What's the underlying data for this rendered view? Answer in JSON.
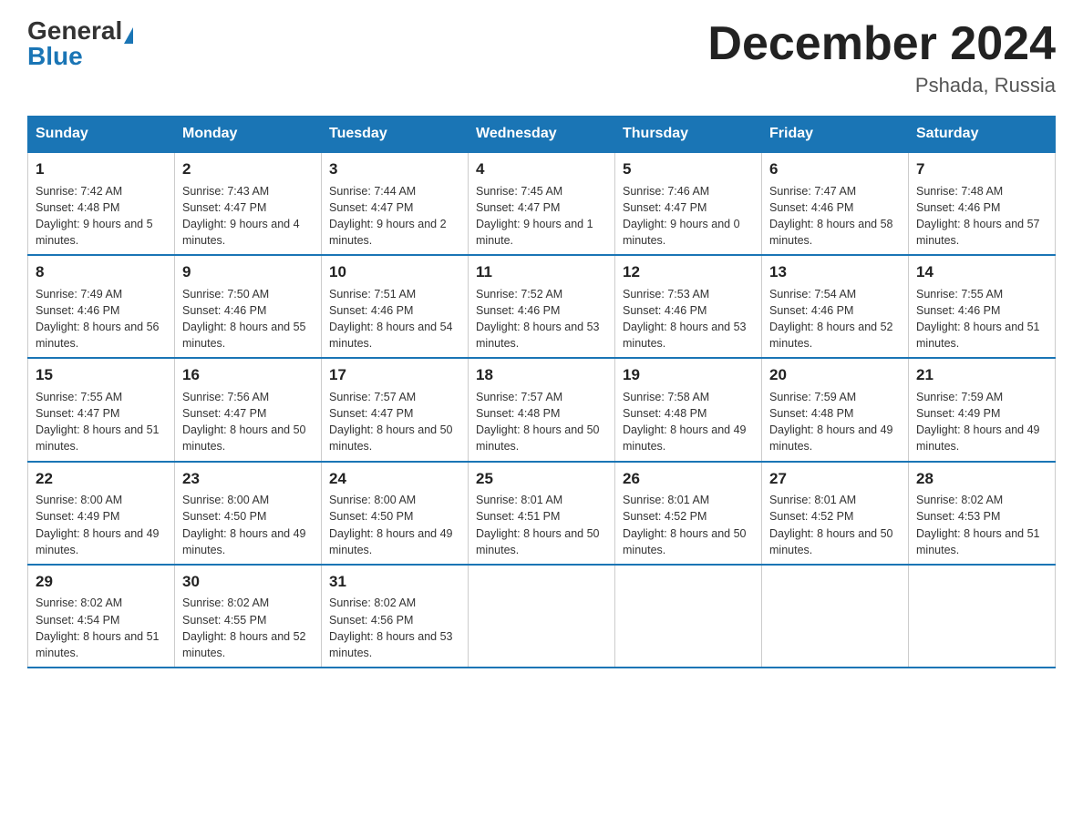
{
  "header": {
    "logo_general": "General",
    "logo_blue": "Blue",
    "month_title": "December 2024",
    "location": "Pshada, Russia"
  },
  "weekdays": [
    "Sunday",
    "Monday",
    "Tuesday",
    "Wednesday",
    "Thursday",
    "Friday",
    "Saturday"
  ],
  "weeks": [
    [
      {
        "day": "1",
        "sunrise": "7:42 AM",
        "sunset": "4:48 PM",
        "daylight": "9 hours and 5 minutes."
      },
      {
        "day": "2",
        "sunrise": "7:43 AM",
        "sunset": "4:47 PM",
        "daylight": "9 hours and 4 minutes."
      },
      {
        "day": "3",
        "sunrise": "7:44 AM",
        "sunset": "4:47 PM",
        "daylight": "9 hours and 2 minutes."
      },
      {
        "day": "4",
        "sunrise": "7:45 AM",
        "sunset": "4:47 PM",
        "daylight": "9 hours and 1 minute."
      },
      {
        "day": "5",
        "sunrise": "7:46 AM",
        "sunset": "4:47 PM",
        "daylight": "9 hours and 0 minutes."
      },
      {
        "day": "6",
        "sunrise": "7:47 AM",
        "sunset": "4:46 PM",
        "daylight": "8 hours and 58 minutes."
      },
      {
        "day": "7",
        "sunrise": "7:48 AM",
        "sunset": "4:46 PM",
        "daylight": "8 hours and 57 minutes."
      }
    ],
    [
      {
        "day": "8",
        "sunrise": "7:49 AM",
        "sunset": "4:46 PM",
        "daylight": "8 hours and 56 minutes."
      },
      {
        "day": "9",
        "sunrise": "7:50 AM",
        "sunset": "4:46 PM",
        "daylight": "8 hours and 55 minutes."
      },
      {
        "day": "10",
        "sunrise": "7:51 AM",
        "sunset": "4:46 PM",
        "daylight": "8 hours and 54 minutes."
      },
      {
        "day": "11",
        "sunrise": "7:52 AM",
        "sunset": "4:46 PM",
        "daylight": "8 hours and 53 minutes."
      },
      {
        "day": "12",
        "sunrise": "7:53 AM",
        "sunset": "4:46 PM",
        "daylight": "8 hours and 53 minutes."
      },
      {
        "day": "13",
        "sunrise": "7:54 AM",
        "sunset": "4:46 PM",
        "daylight": "8 hours and 52 minutes."
      },
      {
        "day": "14",
        "sunrise": "7:55 AM",
        "sunset": "4:46 PM",
        "daylight": "8 hours and 51 minutes."
      }
    ],
    [
      {
        "day": "15",
        "sunrise": "7:55 AM",
        "sunset": "4:47 PM",
        "daylight": "8 hours and 51 minutes."
      },
      {
        "day": "16",
        "sunrise": "7:56 AM",
        "sunset": "4:47 PM",
        "daylight": "8 hours and 50 minutes."
      },
      {
        "day": "17",
        "sunrise": "7:57 AM",
        "sunset": "4:47 PM",
        "daylight": "8 hours and 50 minutes."
      },
      {
        "day": "18",
        "sunrise": "7:57 AM",
        "sunset": "4:48 PM",
        "daylight": "8 hours and 50 minutes."
      },
      {
        "day": "19",
        "sunrise": "7:58 AM",
        "sunset": "4:48 PM",
        "daylight": "8 hours and 49 minutes."
      },
      {
        "day": "20",
        "sunrise": "7:59 AM",
        "sunset": "4:48 PM",
        "daylight": "8 hours and 49 minutes."
      },
      {
        "day": "21",
        "sunrise": "7:59 AM",
        "sunset": "4:49 PM",
        "daylight": "8 hours and 49 minutes."
      }
    ],
    [
      {
        "day": "22",
        "sunrise": "8:00 AM",
        "sunset": "4:49 PM",
        "daylight": "8 hours and 49 minutes."
      },
      {
        "day": "23",
        "sunrise": "8:00 AM",
        "sunset": "4:50 PM",
        "daylight": "8 hours and 49 minutes."
      },
      {
        "day": "24",
        "sunrise": "8:00 AM",
        "sunset": "4:50 PM",
        "daylight": "8 hours and 49 minutes."
      },
      {
        "day": "25",
        "sunrise": "8:01 AM",
        "sunset": "4:51 PM",
        "daylight": "8 hours and 50 minutes."
      },
      {
        "day": "26",
        "sunrise": "8:01 AM",
        "sunset": "4:52 PM",
        "daylight": "8 hours and 50 minutes."
      },
      {
        "day": "27",
        "sunrise": "8:01 AM",
        "sunset": "4:52 PM",
        "daylight": "8 hours and 50 minutes."
      },
      {
        "day": "28",
        "sunrise": "8:02 AM",
        "sunset": "4:53 PM",
        "daylight": "8 hours and 51 minutes."
      }
    ],
    [
      {
        "day": "29",
        "sunrise": "8:02 AM",
        "sunset": "4:54 PM",
        "daylight": "8 hours and 51 minutes."
      },
      {
        "day": "30",
        "sunrise": "8:02 AM",
        "sunset": "4:55 PM",
        "daylight": "8 hours and 52 minutes."
      },
      {
        "day": "31",
        "sunrise": "8:02 AM",
        "sunset": "4:56 PM",
        "daylight": "8 hours and 53 minutes."
      },
      null,
      null,
      null,
      null
    ]
  ],
  "labels": {
    "sunrise": "Sunrise:",
    "sunset": "Sunset:",
    "daylight": "Daylight:"
  }
}
